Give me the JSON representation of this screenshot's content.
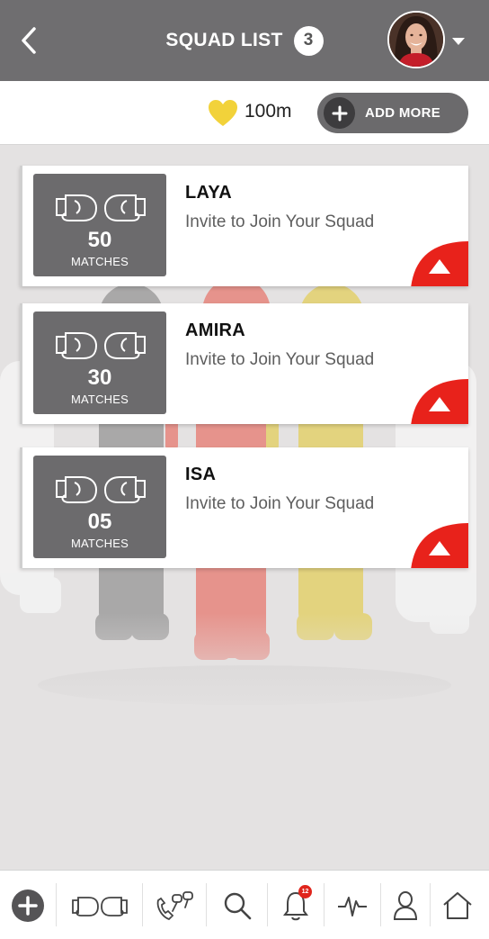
{
  "header": {
    "title": "SQUAD LIST",
    "count": "3"
  },
  "subbar": {
    "distance": "100m",
    "add_more_label": "ADD MORE"
  },
  "squad": [
    {
      "matches": "50",
      "matches_label": "MATCHES",
      "name": "LAYA",
      "subtitle": "Invite to Join Your Squad"
    },
    {
      "matches": "30",
      "matches_label": "MATCHES",
      "name": "AMIRA",
      "subtitle": "Invite to Join Your Squad"
    },
    {
      "matches": "05",
      "matches_label": "MATCHES",
      "name": "ISA",
      "subtitle": "Invite to Join Your Squad"
    }
  ],
  "bottom_nav": {
    "notification_count": "12",
    "items": [
      "add-icon",
      "gloves-icon",
      "call-match-icon",
      "search-icon",
      "bell-icon",
      "activity-icon",
      "profile-icon",
      "home-icon"
    ]
  },
  "colors": {
    "header_bg": "#6f6e70",
    "alert_red": "#e8221b",
    "heart_yellow": "#f2d23a"
  }
}
